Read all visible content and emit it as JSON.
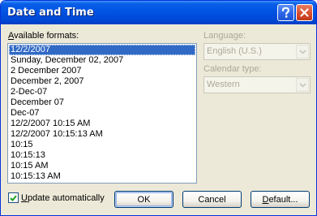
{
  "window": {
    "title": "Date and Time",
    "help_button": "?",
    "close_button": "close"
  },
  "formats": {
    "label_prefix": "",
    "label_accel": "A",
    "label_rest": "vailable formats:",
    "items": [
      "12/2/2007",
      "Sunday, December 02, 2007",
      "2 December 2007",
      "December 2, 2007",
      "2-Dec-07",
      "December 07",
      "Dec-07",
      "12/2/2007 10:15 AM",
      "12/2/2007 10:15:13 AM",
      "10:15",
      "10:15:13",
      "10:15 AM",
      "10:15:13 AM"
    ],
    "selected_index": 0
  },
  "language": {
    "label": "Language:",
    "value": "English (U.S.)"
  },
  "calendar": {
    "label": "Calendar type:",
    "value": "Western"
  },
  "update_auto": {
    "accel": "U",
    "rest": "pdate automatically",
    "checked": true
  },
  "buttons": {
    "ok": "OK",
    "cancel": "Cancel",
    "default_accel": "D",
    "default_rest": "efault..."
  }
}
